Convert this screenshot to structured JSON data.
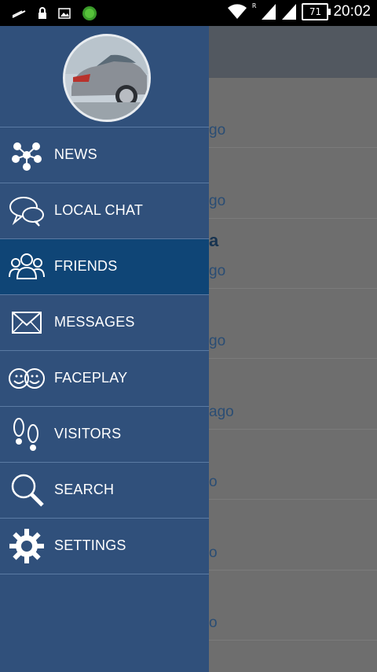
{
  "status_bar": {
    "battery": "71",
    "time": "20:02",
    "signal_label": "R"
  },
  "background_rows": [
    {
      "text": "go"
    },
    {
      "text": "go"
    },
    {
      "text": "go"
    },
    {
      "text": "go"
    },
    {
      "text": "ago"
    },
    {
      "text": "o"
    },
    {
      "text": "o"
    },
    {
      "text": "o"
    }
  ],
  "background_glyph": "a",
  "drawer": {
    "items": [
      {
        "label": "NEWS",
        "icon": "news-network-icon"
      },
      {
        "label": "LOCAL CHAT",
        "icon": "chat-bubbles-icon"
      },
      {
        "label": "FRIENDS",
        "icon": "friends-icon",
        "active": true
      },
      {
        "label": "MESSAGES",
        "icon": "envelope-icon"
      },
      {
        "label": "FACEPLAY",
        "icon": "faceplay-icon"
      },
      {
        "label": "VISITORS",
        "icon": "footprints-icon"
      },
      {
        "label": "SEARCH",
        "icon": "search-icon"
      },
      {
        "label": "SETTINGS",
        "icon": "gear-icon"
      }
    ]
  },
  "colors": {
    "drawer": "#30507b",
    "active_item": "#0f4576",
    "status_bar": "#000000"
  }
}
